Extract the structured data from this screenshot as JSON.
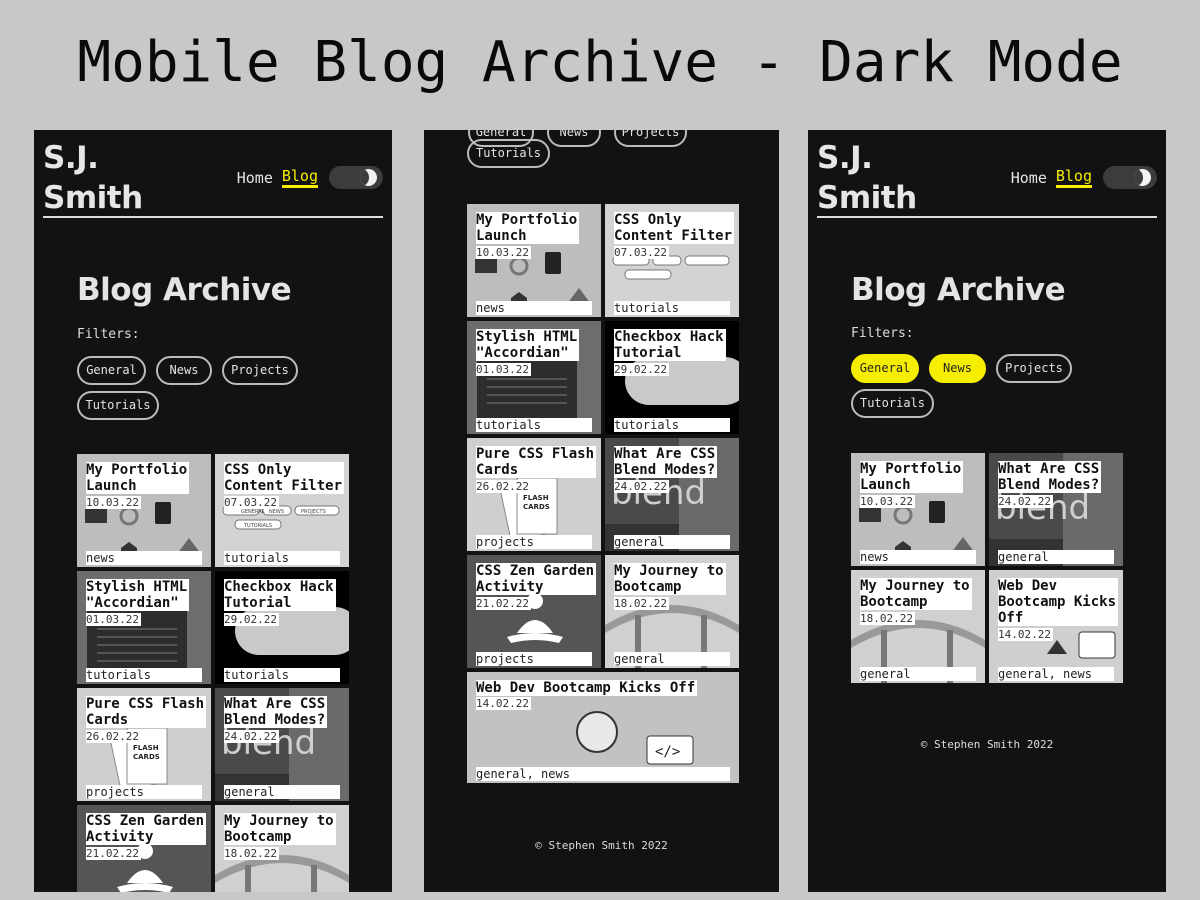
{
  "page_title": "Mobile Blog Archive - Dark Mode",
  "site": {
    "logo": "S.J.\nSmith",
    "nav_home": "Home",
    "nav_blog": "Blog"
  },
  "archive": {
    "title": "Blog Archive",
    "filters_label": "Filters:"
  },
  "filters": [
    "General",
    "News",
    "Projects",
    "Tutorials"
  ],
  "active_filters_screen3": [
    "General",
    "News"
  ],
  "posts": [
    {
      "title": "My Portfolio\nLaunch",
      "date": "10.03.22",
      "tags": "news"
    },
    {
      "title": "CSS Only\nContent Filter",
      "date": "07.03.22",
      "tags": "tutorials",
      "thumb_chips": [
        "GENERAL",
        "NEWS",
        "PROJECTS",
        "TUTORIALS"
      ]
    },
    {
      "title": "Stylish HTML\n\"Accordian\"",
      "date": "01.03.22",
      "tags": "tutorials"
    },
    {
      "title": "Checkbox Hack\nTutorial",
      "date": "29.02.22",
      "tags": "tutorials"
    },
    {
      "title": "Pure CSS Flash\nCards",
      "date": "26.02.22",
      "tags": "projects",
      "thumb_text": "FLASH\nCARDS"
    },
    {
      "title": "What Are CSS\nBlend Modes?",
      "date": "24.02.22",
      "tags": "general",
      "thumb_text": "blend"
    },
    {
      "title": "CSS Zen Garden\nActivity",
      "date": "21.02.22",
      "tags": "projects"
    },
    {
      "title": "My Journey to\nBootcamp",
      "date": "18.02.22",
      "tags": "general"
    },
    {
      "title": "Web Dev Bootcamp Kicks Off",
      "date": "14.02.22",
      "tags": "general, news",
      "thumb_text": "</>"
    }
  ],
  "filtered_posts": [
    {
      "title": "My Portfolio\nLaunch",
      "date": "10.03.22",
      "tags": "news"
    },
    {
      "title": "What Are CSS\nBlend Modes?",
      "date": "24.02.22",
      "tags": "general",
      "thumb_text": "blend"
    },
    {
      "title": "My Journey to\nBootcamp",
      "date": "18.02.22",
      "tags": "general"
    },
    {
      "title": "Web Dev\nBootcamp Kicks\nOff",
      "date": "14.02.22",
      "tags": "general, news"
    }
  ],
  "footer": "© Stephen Smith 2022",
  "colors": {
    "accent": "#f5ee00",
    "background": "#121212",
    "outer": "#c8c8c8"
  }
}
